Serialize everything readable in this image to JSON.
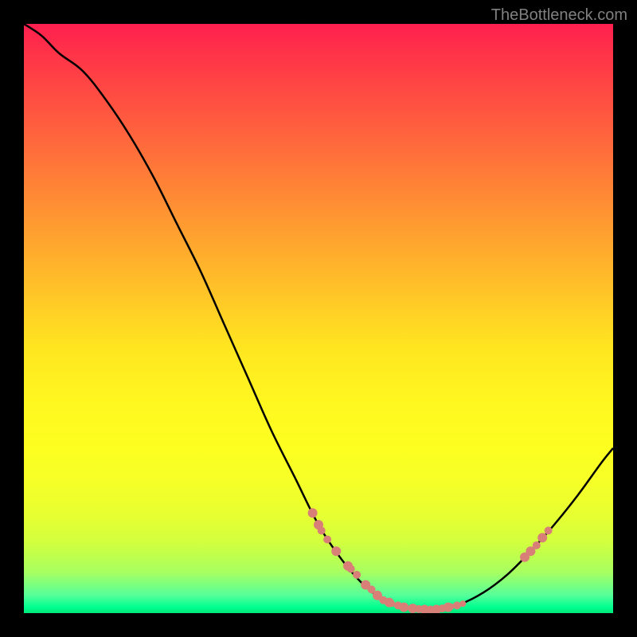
{
  "watermark": "TheBottleneck.com",
  "chart_data": {
    "type": "line",
    "title": "",
    "xlabel": "",
    "ylabel": "",
    "xlim": [
      0,
      100
    ],
    "ylim": [
      0,
      100
    ],
    "curve_points": [
      {
        "x": 0,
        "y": 100
      },
      {
        "x": 3,
        "y": 98
      },
      {
        "x": 6,
        "y": 95
      },
      {
        "x": 10,
        "y": 92
      },
      {
        "x": 14,
        "y": 87
      },
      {
        "x": 18,
        "y": 81
      },
      {
        "x": 22,
        "y": 74
      },
      {
        "x": 26,
        "y": 66
      },
      {
        "x": 30,
        "y": 58
      },
      {
        "x": 34,
        "y": 49
      },
      {
        "x": 38,
        "y": 40
      },
      {
        "x": 42,
        "y": 31
      },
      {
        "x": 46,
        "y": 23
      },
      {
        "x": 50,
        "y": 15
      },
      {
        "x": 54,
        "y": 9
      },
      {
        "x": 58,
        "y": 4.5
      },
      {
        "x": 62,
        "y": 1.8
      },
      {
        "x": 66,
        "y": 0.8
      },
      {
        "x": 70,
        "y": 0.6
      },
      {
        "x": 74,
        "y": 1.5
      },
      {
        "x": 78,
        "y": 3.5
      },
      {
        "x": 82,
        "y": 6.5
      },
      {
        "x": 86,
        "y": 10.5
      },
      {
        "x": 90,
        "y": 15
      },
      {
        "x": 94,
        "y": 20
      },
      {
        "x": 98,
        "y": 25.5
      },
      {
        "x": 100,
        "y": 28
      }
    ],
    "markers": [
      {
        "x": 49,
        "y": 17,
        "size": 6
      },
      {
        "x": 50,
        "y": 15,
        "size": 6
      },
      {
        "x": 50.5,
        "y": 14,
        "size": 5
      },
      {
        "x": 51.5,
        "y": 12.5,
        "size": 5
      },
      {
        "x": 53,
        "y": 10.5,
        "size": 6
      },
      {
        "x": 55,
        "y": 8,
        "size": 6
      },
      {
        "x": 55.5,
        "y": 7.5,
        "size": 5
      },
      {
        "x": 56.5,
        "y": 6.5,
        "size": 5
      },
      {
        "x": 58,
        "y": 4.8,
        "size": 6
      },
      {
        "x": 59,
        "y": 4,
        "size": 5
      },
      {
        "x": 60,
        "y": 3,
        "size": 6
      },
      {
        "x": 61,
        "y": 2.2,
        "size": 5
      },
      {
        "x": 62,
        "y": 1.8,
        "size": 6
      },
      {
        "x": 62.5,
        "y": 1.6,
        "size": 4
      },
      {
        "x": 63.5,
        "y": 1.3,
        "size": 5
      },
      {
        "x": 64.5,
        "y": 1.0,
        "size": 6
      },
      {
        "x": 66,
        "y": 0.8,
        "size": 6
      },
      {
        "x": 67,
        "y": 0.7,
        "size": 5
      },
      {
        "x": 68,
        "y": 0.6,
        "size": 6
      },
      {
        "x": 69,
        "y": 0.6,
        "size": 5
      },
      {
        "x": 70,
        "y": 0.6,
        "size": 6
      },
      {
        "x": 71,
        "y": 0.8,
        "size": 5
      },
      {
        "x": 72,
        "y": 1.0,
        "size": 6
      },
      {
        "x": 72.5,
        "y": 1.1,
        "size": 4
      },
      {
        "x": 73.5,
        "y": 1.3,
        "size": 5
      },
      {
        "x": 74.5,
        "y": 1.6,
        "size": 4
      },
      {
        "x": 85,
        "y": 9.5,
        "size": 6
      },
      {
        "x": 86,
        "y": 10.5,
        "size": 6
      },
      {
        "x": 87,
        "y": 11.5,
        "size": 5
      },
      {
        "x": 88,
        "y": 12.8,
        "size": 6
      },
      {
        "x": 89,
        "y": 14,
        "size": 5
      }
    ],
    "gradient_stops": [
      {
        "pos": 0,
        "color": "#ff1f4f"
      },
      {
        "pos": 100,
        "color": "#00e87a"
      }
    ]
  }
}
